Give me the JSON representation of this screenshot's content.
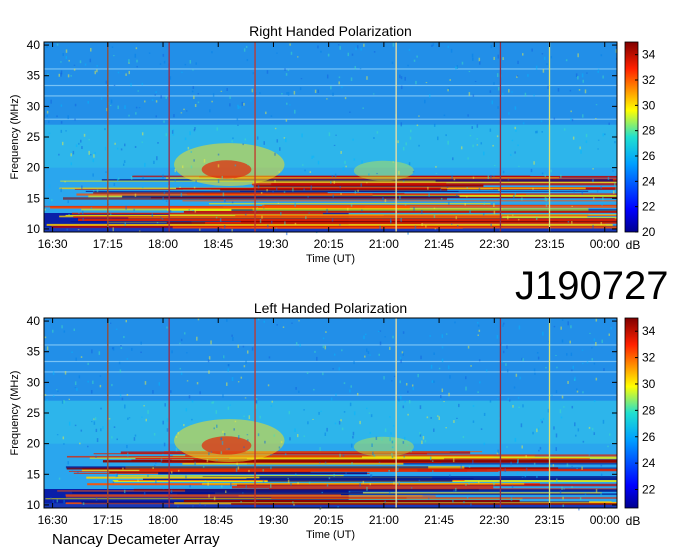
{
  "chart_data": [
    {
      "type": "heatmap",
      "title": "Right Handed Polarization",
      "xlabel": "Time (UT)",
      "ylabel": "Frequency (MHz)",
      "x_ticks": [
        "16:30",
        "17:15",
        "18:00",
        "18:45",
        "19:30",
        "20:15",
        "21:00",
        "21:45",
        "22:30",
        "23:15",
        "00:00"
      ],
      "y_ticks": [
        10,
        15,
        20,
        25,
        30,
        35,
        40
      ],
      "ylim": [
        9.5,
        40.5
      ],
      "colorbar": {
        "label": "dB",
        "ticks": [
          20,
          22,
          24,
          26,
          28,
          30,
          32,
          34
        ],
        "range": [
          20,
          35
        ]
      },
      "vertical_lines": [
        {
          "time": "17:15",
          "color": "#9b4a2e"
        },
        {
          "time": "18:05",
          "color": "#9a2a4a"
        },
        {
          "time": "19:15",
          "color": "#c2362a"
        },
        {
          "time": "21:10",
          "color": "#f0e2a0"
        },
        {
          "time": "22:35",
          "color": "#8a2f4a"
        },
        {
          "time": "23:15",
          "color": "#d9e27a"
        }
      ]
    },
    {
      "type": "heatmap",
      "title": "Left Handed Polarization",
      "xlabel": "Time (UT)",
      "ylabel": "Frequency (MHz)",
      "x_ticks": [
        "16:30",
        "17:15",
        "18:00",
        "18:45",
        "19:30",
        "20:15",
        "21:00",
        "21:45",
        "22:30",
        "23:15",
        "00:00"
      ],
      "y_ticks": [
        10,
        15,
        20,
        25,
        30,
        35,
        40
      ],
      "ylim": [
        9.5,
        40.5
      ],
      "colorbar": {
        "label": "dB",
        "ticks": [
          22,
          24,
          26,
          28,
          30,
          32,
          34
        ],
        "range": [
          20.6,
          35
        ]
      },
      "vertical_lines": [
        {
          "time": "17:15",
          "color": "#9b4a2e"
        },
        {
          "time": "18:05",
          "color": "#9a2a4a"
        },
        {
          "time": "19:15",
          "color": "#c2362a"
        },
        {
          "time": "21:10",
          "color": "#f0e2a0"
        },
        {
          "time": "22:35",
          "color": "#8a2f4a"
        },
        {
          "time": "23:15",
          "color": "#d9e27a"
        }
      ]
    }
  ],
  "observation_id": "J190727",
  "instrument": "Nancay Decameter Array"
}
